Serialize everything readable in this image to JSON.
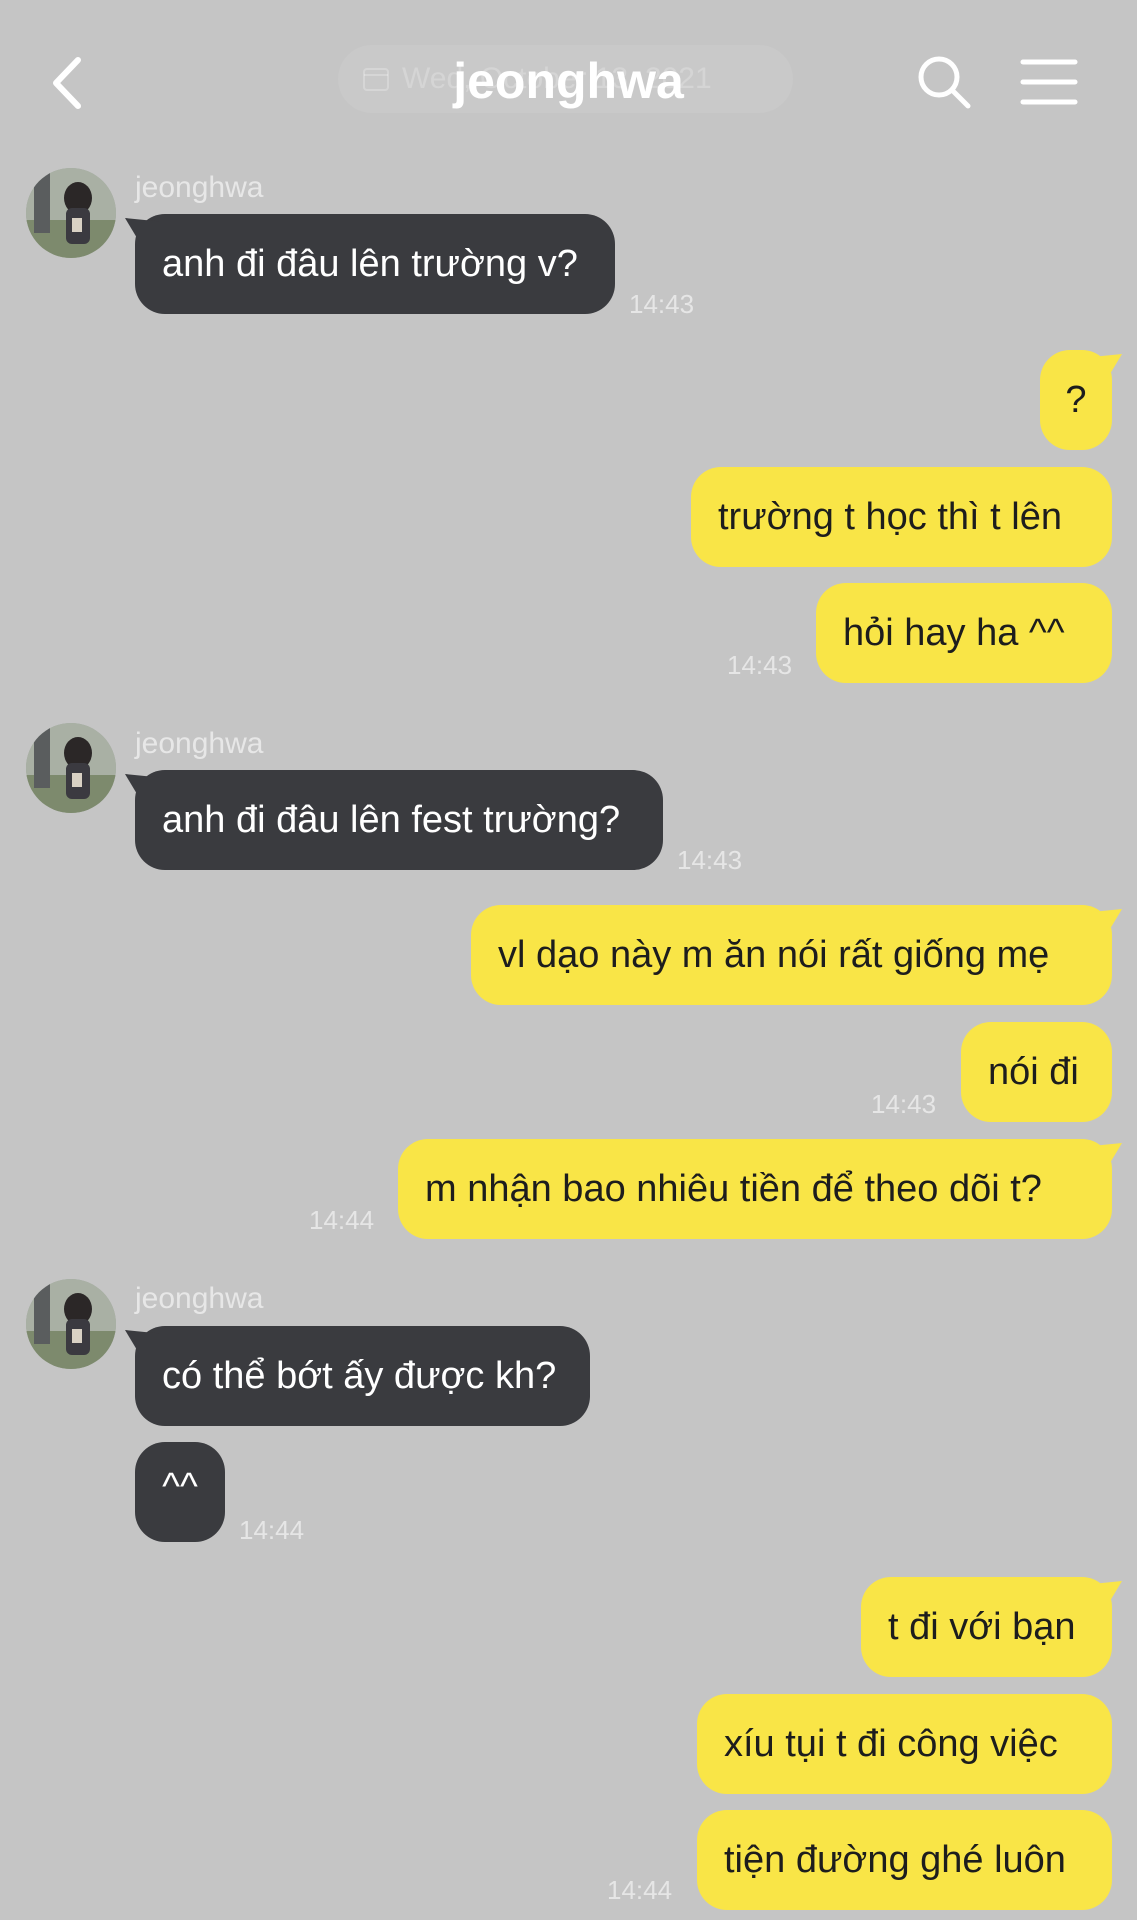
{
  "header": {
    "back_icon": "chevron-left-icon",
    "title": "jeonghwa",
    "date_pill": "Wed, October 13, 2021",
    "search_icon": "search-icon",
    "menu_icon": "hamburger-menu-icon"
  },
  "colors": {
    "background": "#c5c5c5",
    "incoming_bubble": "#3a3b3f",
    "outgoing_bubble": "#f9e547"
  },
  "messages": [
    {
      "direction": "in",
      "sender": "jeonghwa",
      "text": "anh đi đâu lên trường v?",
      "time": "14:43"
    },
    {
      "direction": "out",
      "text": "?"
    },
    {
      "direction": "out",
      "text": "trường t học thì t lên"
    },
    {
      "direction": "out",
      "text": "hỏi hay ha ^^",
      "time": "14:43"
    },
    {
      "direction": "in",
      "sender": "jeonghwa",
      "text": "anh đi đâu lên fest trường?",
      "time": "14:43"
    },
    {
      "direction": "out",
      "text": "vl dạo này m ăn nói rất giống mẹ"
    },
    {
      "direction": "out",
      "text": "nói đi",
      "time": "14:43"
    },
    {
      "direction": "out",
      "text": "m nhận bao nhiêu tiền để theo dõi t?",
      "time": "14:44"
    },
    {
      "direction": "in",
      "sender": "jeonghwa",
      "text": "có thể bớt ấy được kh?"
    },
    {
      "direction": "in",
      "text": "^^",
      "time": "14:44"
    },
    {
      "direction": "out",
      "text": "t đi với bạn"
    },
    {
      "direction": "out",
      "text": "xíu tụi t đi công việc"
    },
    {
      "direction": "out",
      "text": "tiện đường ghé luôn",
      "time": "14:44"
    }
  ]
}
